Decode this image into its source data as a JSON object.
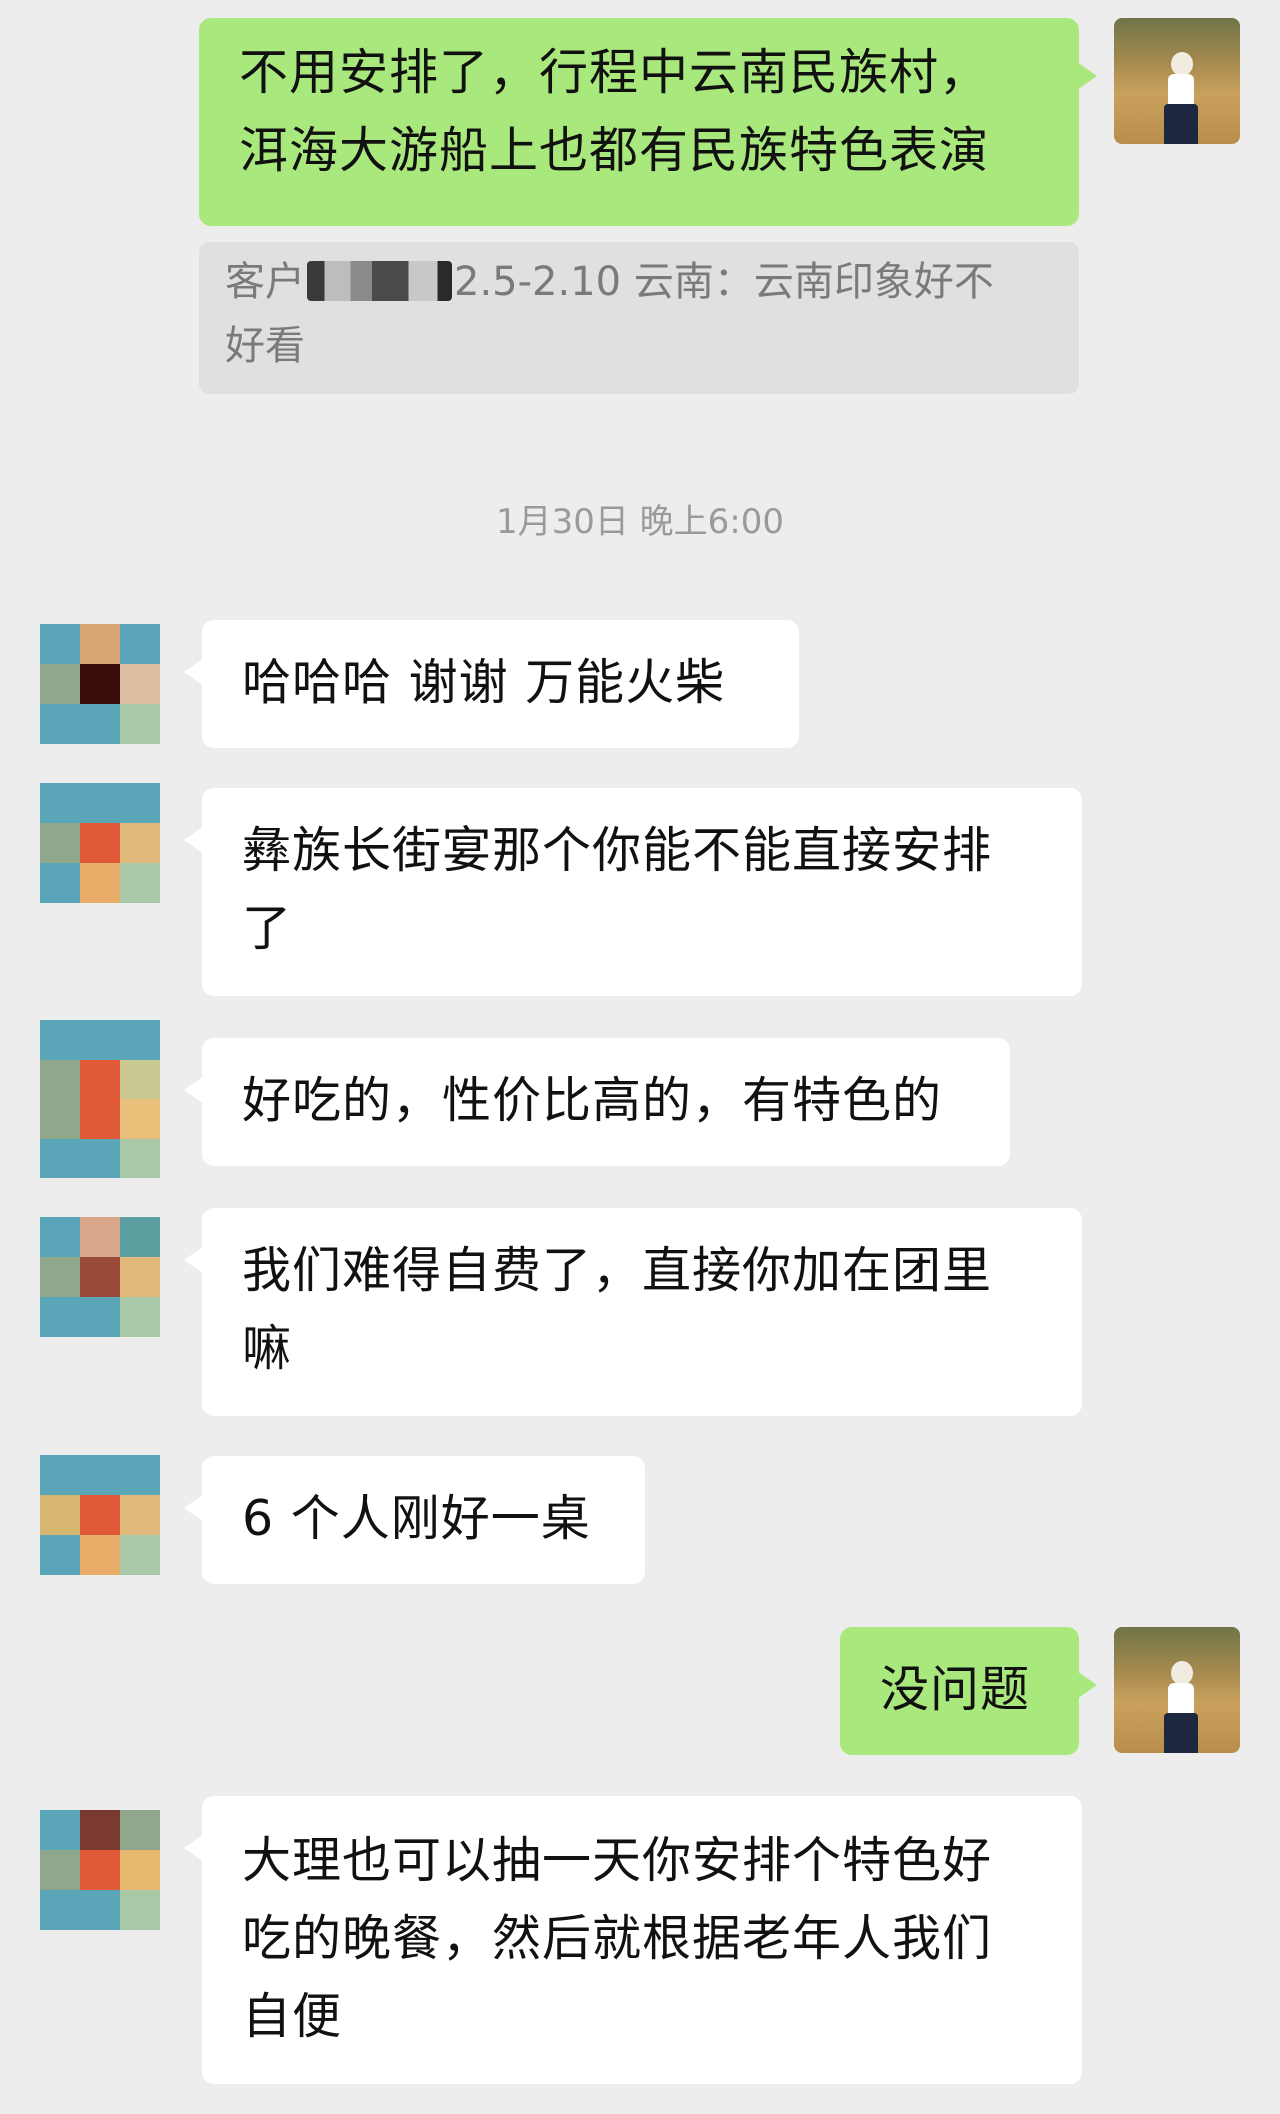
{
  "messages": {
    "m1": {
      "lines": [
        "不用安排了，行程中云南民族村，",
        "洱海大游船上也都有民族特色表演"
      ]
    },
    "quote": {
      "prefix": "客户",
      "suffix": "2.5-2.10 云南：云南印象好不",
      "line2": "好看"
    },
    "timestamp": "1月30日 晚上6:00",
    "m2": {
      "lines": [
        "哈哈哈 谢谢 万能火柴"
      ]
    },
    "m3": {
      "lines": [
        "彝族长街宴那个你能不能直接安排",
        "了"
      ]
    },
    "m4": {
      "lines": [
        "好吃的，性价比高的，有特色的"
      ]
    },
    "m5": {
      "lines": [
        "我们难得自费了，直接你加在团里",
        "嘛"
      ]
    },
    "m6": {
      "lines": [
        "6 个人刚好一桌"
      ]
    },
    "m7": {
      "lines": [
        "没问题"
      ]
    },
    "m8": {
      "lines": [
        "大理也可以抽一天你安排个特色好",
        "吃的晚餐，然后就根据老年人我们",
        "自便"
      ]
    }
  },
  "colors": {
    "background": "#ededed",
    "self_bubble": "#a9e87c",
    "other_bubble": "#ffffff",
    "quote_bg": "#e0e0e0"
  },
  "avatars": {
    "a1": [
      "#5aa6b8",
      "#d9a574",
      "#5aa6b8",
      "#8fa88c",
      "#3a0d0a",
      "#dcbfa0",
      "#5aa6b8",
      "#5aa6b8",
      "#a9c8a8"
    ],
    "a2": [
      "#5aa6b8",
      "#5aa6b8",
      "#5aa6b8",
      "#8fa88c",
      "#e05a38",
      "#e0b87a",
      "#5aa6b8",
      "#e8ae6a",
      "#a9c8a8"
    ],
    "a3": [
      "#5aa6b8",
      "#5aa6b8",
      "#5aa6b8",
      "#8fa88c",
      "#e05a38",
      "#c8c890",
      "#8fa88c",
      "#e05a38",
      "#e8c07a",
      "#5aa6b8",
      "#5aa6b8",
      "#a9c8a8"
    ],
    "a4": [
      "#5aa6b8",
      "#d9a88a",
      "#5a9ea0",
      "#8fa88c",
      "#9a4a38",
      "#e0b87a",
      "#5aa6b8",
      "#5aa6b8",
      "#a9c8a8"
    ],
    "a5": [
      "#5aa6b8",
      "#5aa6b8",
      "#5aa6b8",
      "#d8b870",
      "#e05a38",
      "#e0b87a",
      "#5aa6b8",
      "#e8ae6a",
      "#a9c8a8"
    ],
    "a6": [
      "#5aa6b8",
      "#7a3a30",
      "#8fa88c",
      "#8fa88c",
      "#e05a38",
      "#e8b870",
      "#5aa6b8",
      "#5aa6b8",
      "#a9c8a8"
    ]
  }
}
